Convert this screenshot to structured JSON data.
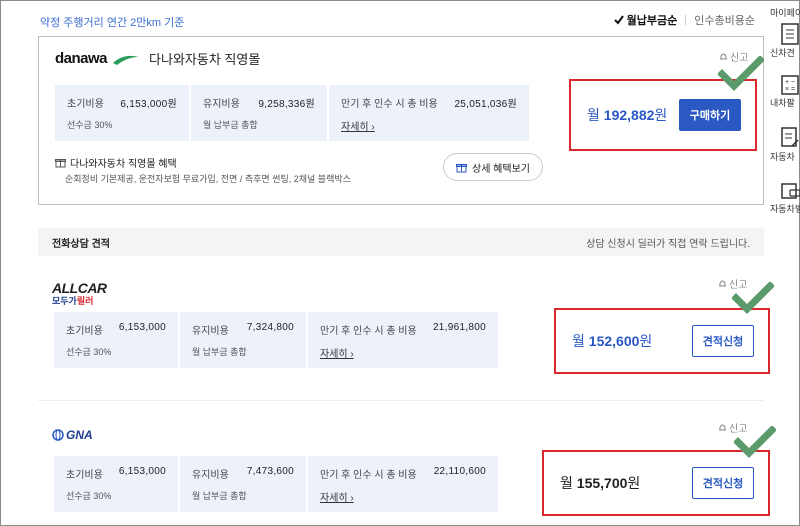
{
  "header": {
    "note": "약정 주행거리 연간 2만km 기준",
    "sort_active": "월납부금순",
    "sort_inactive": "인수총비용순"
  },
  "sidebar": {
    "items": [
      {
        "label": "마이페이",
        "icon": "user-list-icon"
      },
      {
        "label": "신차견",
        "icon": "document-icon"
      },
      {
        "label": "내차팔",
        "icon": "calculator-icon"
      },
      {
        "label": "자동차",
        "icon": "document-edit-icon"
      },
      {
        "label": "자동차빌",
        "icon": "car-document-icon"
      }
    ]
  },
  "direct": {
    "logo": "danawa",
    "title": "다나와자동차 직영몰",
    "report": "신고",
    "info": {
      "initial_label": "초기비용",
      "initial_value": "6,153,000원",
      "initial_sub": "선수금 30%",
      "maint_label": "유지비용",
      "maint_value": "9,258,336원",
      "maint_sub": "월 납부금 총합",
      "total_label": "만기 후 인수 시 총 비용",
      "total_value": "25,051,036원",
      "detail_link": "자세히"
    },
    "price": "192,882",
    "price_prefix": "월",
    "price_suffix": "원",
    "button": "구매하기",
    "benefit_title": "다나와자동차 직영몰 혜택",
    "benefit_desc": "순회정비 기본제공, 운전자보험 무료가입, 전면 / 측후면 썬팅, 2채널 블랙박스",
    "benefit_button": "상세 혜택보기"
  },
  "phone_section": {
    "title": "전화상담 견적",
    "note": "상담 신청시 딜러가 직접 연락 드립니다."
  },
  "dealers": [
    {
      "logo_top": "ALLCAR",
      "logo_bottom_a": "모두가",
      "logo_bottom_b": "릴러",
      "report": "신고",
      "initial_label": "초기비용",
      "initial_value": "6,153,000",
      "initial_sub": "선수금 30%",
      "maint_label": "유지비용",
      "maint_value": "7,324,800",
      "maint_sub": "월 납부금 총합",
      "total_label": "만기 후 인수 시 총 비용",
      "total_value": "21,961,800",
      "detail_link": "자세히",
      "price_prefix": "월",
      "price": "152,600",
      "price_suffix": "원",
      "button": "견적신청"
    },
    {
      "logo_top": "GNA",
      "report": "신고",
      "initial_label": "초기비용",
      "initial_value": "6,153,000",
      "initial_sub": "선수금 30%",
      "maint_label": "유지비용",
      "maint_value": "7,473,600",
      "maint_sub": "월 납부금 총합",
      "total_label": "만기 후 인수 시 총 비용",
      "total_value": "22,110,600",
      "detail_link": "자세히",
      "price_prefix": "월",
      "price": "155,700",
      "price_suffix": "원",
      "button": "견적신청"
    }
  ],
  "colors": {
    "accent": "#2b59c3",
    "highlight_border": "#d9272e",
    "check": "#5b9a6b",
    "info_bg": "#edf1fa"
  }
}
